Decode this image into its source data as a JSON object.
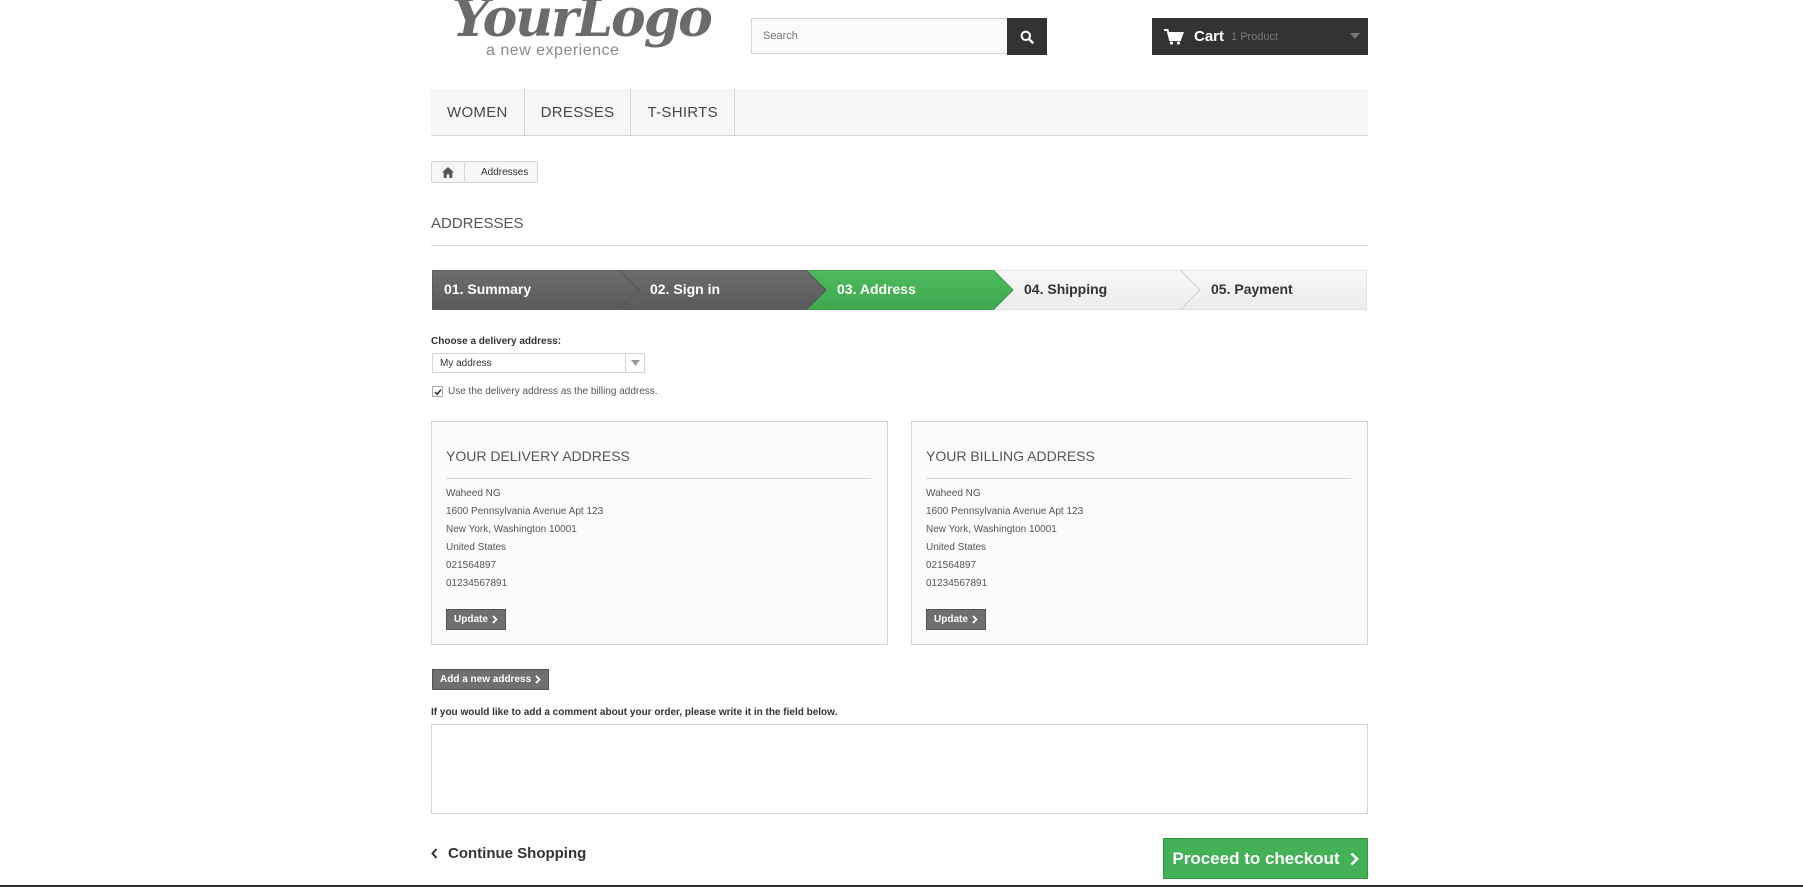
{
  "header": {
    "logo_main": "YourLogo",
    "logo_tagline": "a new experience",
    "search_placeholder": "Search",
    "cart_label": "Cart",
    "cart_count": "1 Product"
  },
  "menu": {
    "items": [
      {
        "label": "WOMEN"
      },
      {
        "label": "DRESSES"
      },
      {
        "label": "T-SHIRTS"
      }
    ]
  },
  "breadcrumb": {
    "current": "Addresses"
  },
  "page": {
    "title": "ADDRESSES"
  },
  "steps": [
    {
      "label": "01. Summary",
      "state": "done"
    },
    {
      "label": "02. Sign in",
      "state": "done"
    },
    {
      "label": "03. Address",
      "state": "current"
    },
    {
      "label": "04. Shipping",
      "state": "todo"
    },
    {
      "label": "05. Payment",
      "state": "todo"
    }
  ],
  "delivery": {
    "choose_label": "Choose a delivery address:",
    "selected": "My address",
    "same_billing_label": "Use the delivery address as the billing address.",
    "same_billing_checked": true
  },
  "delivery_address": {
    "title": "YOUR DELIVERY ADDRESS",
    "lines": [
      "Waheed NG",
      "1600 Pennsylvania Avenue Apt 123",
      "New York, Washington 10001",
      "United States",
      "021564897",
      "01234567891"
    ],
    "update_label": "Update"
  },
  "billing_address": {
    "title": "YOUR BILLING ADDRESS",
    "lines": [
      "Waheed NG",
      "1600 Pennsylvania Avenue Apt 123",
      "New York, Washington 10001",
      "United States",
      "021564897",
      "01234567891"
    ],
    "update_label": "Update"
  },
  "actions": {
    "add_address_label": "Add a new address",
    "comment_label": "If you would like to add a comment about your order, please write it in the field below.",
    "comment_value": "",
    "continue_label": "Continue Shopping",
    "checkout_label": "Proceed to checkout"
  },
  "colors": {
    "accent_green": "#43b155",
    "dark": "#333333",
    "step_done": "#666666",
    "step_todo": "#f4f4f4"
  }
}
